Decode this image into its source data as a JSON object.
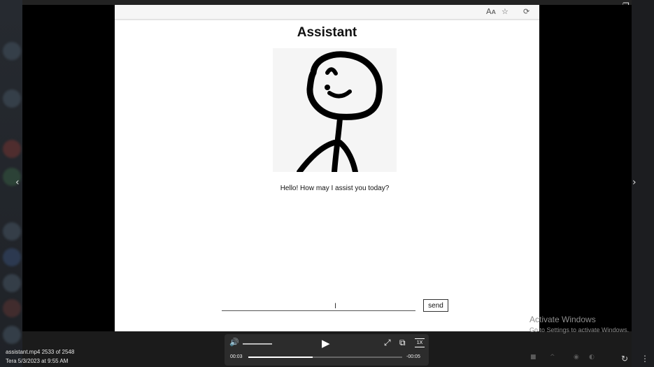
{
  "window": {
    "minimize_glyph": "—",
    "restore_glyph": "❐",
    "close_glyph": "✕"
  },
  "browser": {
    "toolbar_icons": [
      "read-aloud-icon",
      "favorites-icon",
      "extensions-icon"
    ],
    "read_aloud_glyph": "Aᴀ",
    "favorites_glyph": "☆",
    "extensions_glyph": "⟳"
  },
  "page": {
    "title": "Assistant",
    "greeting": "Hello! How may I assist you today?",
    "input_value": "",
    "send_label": "send"
  },
  "viewer": {
    "prev_glyph": "‹",
    "next_glyph": "›"
  },
  "watermark": {
    "line1": "Activate Windows",
    "line2": "Go to Settings to activate Windows."
  },
  "file": {
    "name_and_count": "assistant.mp4 2533 of 2548",
    "owner_and_date": "Tera   5/3/2023 at 9:55 AM"
  },
  "player": {
    "elapsed": "00:03",
    "remaining": "-00:05",
    "speed": "1X",
    "progress": 0.42,
    "volume": 1.0,
    "volume_glyph": "🔊",
    "play_glyph": "▶",
    "fullscreen_glyph": "⤢",
    "miniplayer_glyph": "⧉"
  },
  "colors": {
    "background": "#000000",
    "player_bg": "#2c2c2c",
    "page_bg": "#ffffff"
  }
}
